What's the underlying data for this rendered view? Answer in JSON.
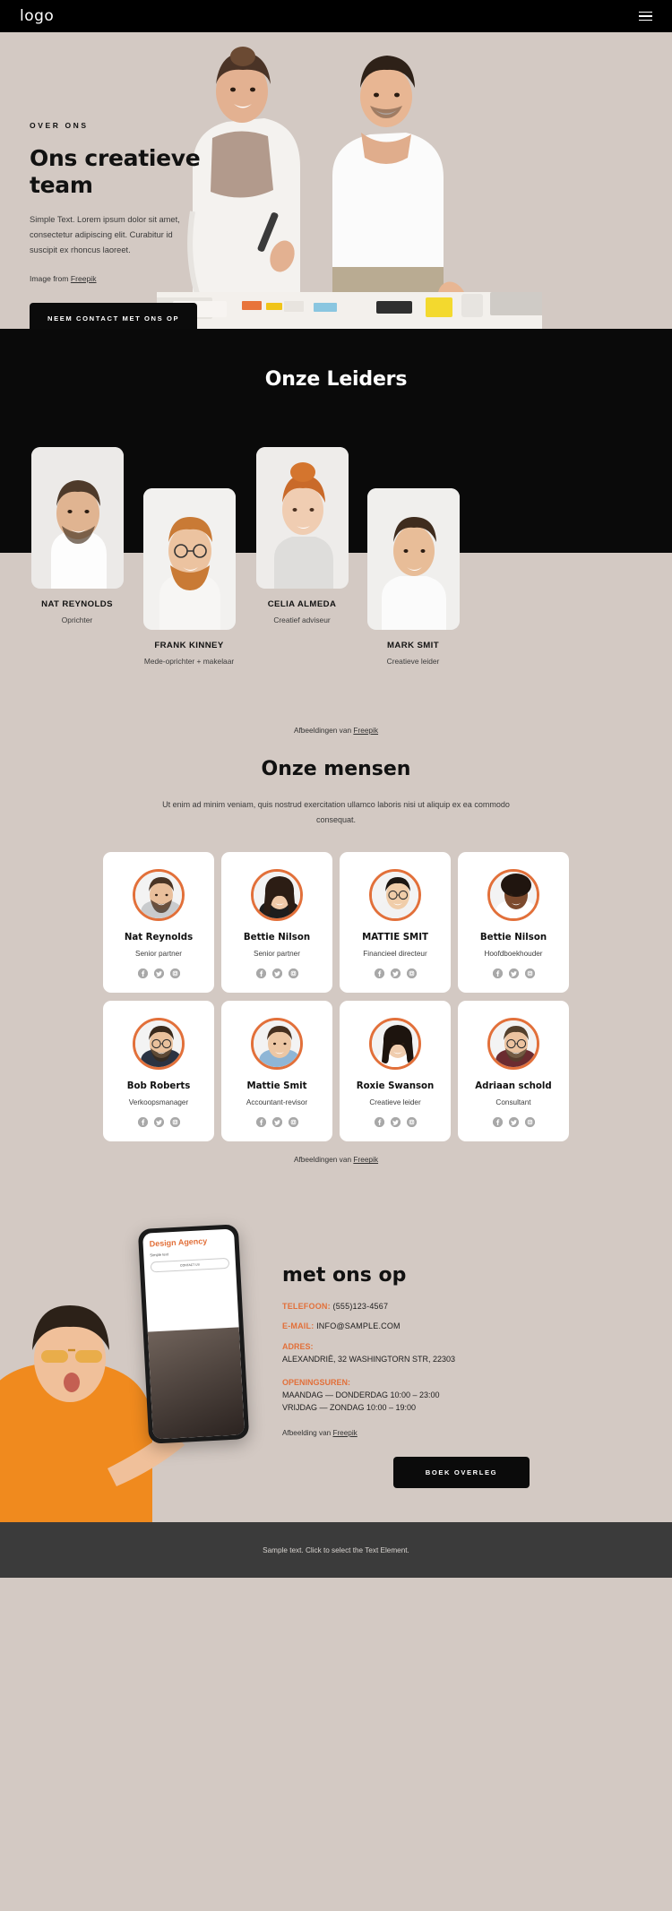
{
  "header": {
    "logo": "logo",
    "menu_icon": "hamburger-menu-icon"
  },
  "hero": {
    "eyebrow": "OVER ONS",
    "title": "Ons creatieve team",
    "paragraph": "Simple Text. Lorem ipsum dolor sit amet, consectetur adipiscing elit. Curabitur id suscipit ex rhoncus laoreet.",
    "credit_prefix": "Image from ",
    "credit_link": "Freepik",
    "cta": "NEEM CONTACT MET ONS OP"
  },
  "leaders": {
    "title": "Onze Leiders",
    "credit_prefix": "Afbeeldingen van ",
    "credit_link": "Freepik",
    "items": [
      {
        "name": "NAT REYNOLDS",
        "role": "Oprichter"
      },
      {
        "name": "FRANK KINNEY",
        "role": "Mede-oprichter + makelaar"
      },
      {
        "name": "CELIA ALMEDA",
        "role": "Creatief adviseur"
      },
      {
        "name": "MARK SMIT",
        "role": "Creatieve leider"
      }
    ]
  },
  "people": {
    "title": "Onze mensen",
    "subtitle": "Ut enim ad minim veniam, quis nostrud exercitation ullamco laboris nisi ut aliquip ex ea commodo consequat.",
    "credit_prefix": "Afbeeldingen van ",
    "credit_link": "Freepik",
    "social_icons": [
      "facebook-icon",
      "twitter-icon",
      "instagram-icon"
    ],
    "accent_color": "#e2703a",
    "members": [
      {
        "name": "Nat Reynolds",
        "role": "Senior partner"
      },
      {
        "name": "Bettie Nilson",
        "role": "Senior partner"
      },
      {
        "name": "MATTIE SMIT",
        "role": "Financieel directeur"
      },
      {
        "name": "Bettie Nilson",
        "role": "Hoofdboekhouder"
      },
      {
        "name": "Bob Roberts",
        "role": "Verkoopsmanager"
      },
      {
        "name": "Mattie Smit",
        "role": "Accountant-revisor"
      },
      {
        "name": "Roxie Swanson",
        "role": "Creatieve leider"
      },
      {
        "name": "Adriaan schold",
        "role": "Consultant"
      }
    ]
  },
  "contact": {
    "title": "met ons op",
    "phone_label": "TELEFOON:",
    "phone_value": "(555)123-4567",
    "email_label": "E-MAIL:",
    "email_value": "INFO@SAMPLE.COM",
    "address_label": "ADRES:",
    "address_value": "ALEXANDRIË, 32 WASHINGTORN STR, 22303",
    "hours_label": "OPENINGSUREN:",
    "hours_line1": "MAANDAG — DONDERDAG 10:00 – 23:00",
    "hours_line2": "VRIJDAG — ZONDAG 10:00 – 19:00",
    "credit_prefix": "Afbeelding van ",
    "credit_link": "Freepik",
    "cta": "BOEK OVERLEG",
    "phone_mock": {
      "title": "Design Agency",
      "subtitle": "Simple text",
      "button": "CONTACT US"
    }
  },
  "footer": {
    "text": "Sample text. Click to select the Text Element."
  }
}
